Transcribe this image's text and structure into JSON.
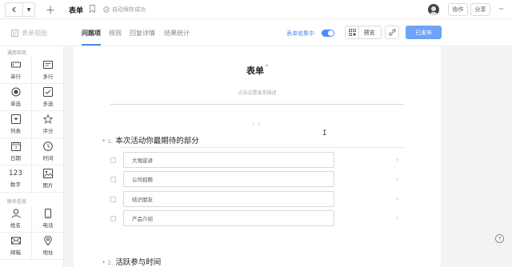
{
  "topbar": {
    "title": "表单",
    "save_status": "自动保存成功",
    "collaborate_label": "协作",
    "share_label": "分享",
    "more_label": "···"
  },
  "toolbar": {
    "form_view_label": "表单视图",
    "tabs": [
      {
        "label": "问题项",
        "active": true
      },
      {
        "label": "规则",
        "active": false
      },
      {
        "label": "回复详情",
        "active": false
      },
      {
        "label": "结果统计",
        "active": false
      }
    ],
    "collecting_label": "表单收集中",
    "collecting_on": true,
    "preview_label": "预览",
    "publish_label": "已发布",
    "accent_color": "#4a8cf6"
  },
  "sidebar": {
    "common_title": "通用项目",
    "common_items": [
      {
        "label": "单行",
        "icon": "single-line-icon"
      },
      {
        "label": "多行",
        "icon": "multi-line-icon"
      },
      {
        "label": "单选",
        "icon": "radio-icon"
      },
      {
        "label": "多选",
        "icon": "checkbox-icon"
      },
      {
        "label": "列表",
        "icon": "dropdown-icon"
      },
      {
        "label": "评分",
        "icon": "star-icon"
      },
      {
        "label": "日期",
        "icon": "calendar-icon"
      },
      {
        "label": "时间",
        "icon": "clock-icon"
      },
      {
        "label": "数字",
        "icon": "number-icon",
        "glyph": "123"
      },
      {
        "label": "图片",
        "icon": "image-icon"
      }
    ],
    "contact_title": "联系信息",
    "contact_items": [
      {
        "label": "姓名",
        "icon": "person-icon"
      },
      {
        "label": "电话",
        "icon": "phone-icon"
      },
      {
        "label": "邮箱",
        "icon": "mail-icon"
      },
      {
        "label": "地址",
        "icon": "location-icon"
      }
    ]
  },
  "form": {
    "title": "表单",
    "title_required_mark": "*",
    "description_placeholder": "点击设置表单描述",
    "drag_handle": "⋮⋮",
    "questions": [
      {
        "required_mark": "*",
        "number": "1.",
        "text": "本次活动你最期待的部分",
        "options": [
          "大咖宣讲",
          "公司招聘",
          "结识朋友",
          "产品介绍"
        ]
      },
      {
        "required_mark": "*",
        "number": "2.",
        "text": "活跃参与时间"
      }
    ]
  },
  "help": {
    "label": "?"
  }
}
